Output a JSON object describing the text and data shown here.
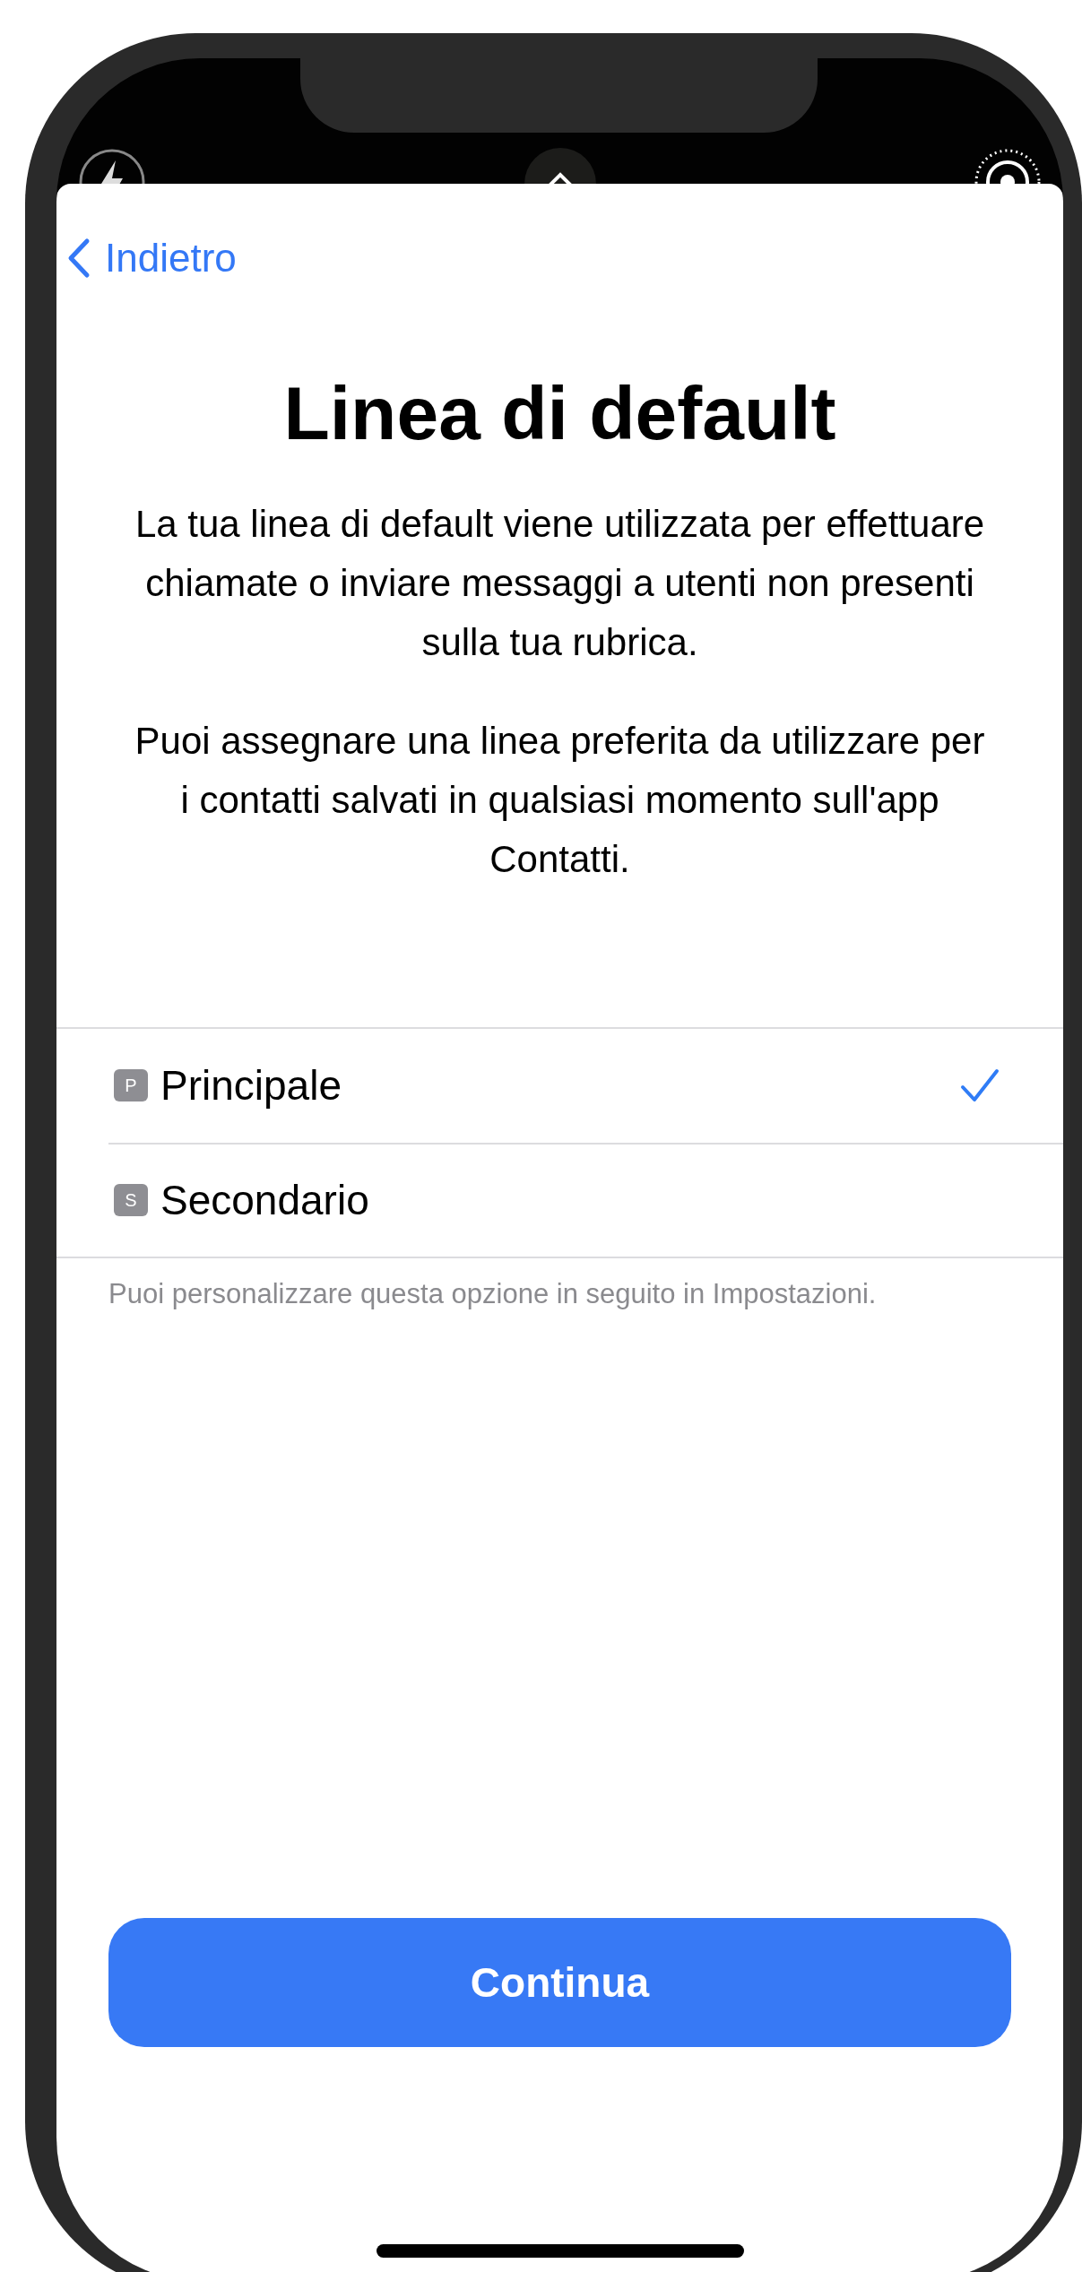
{
  "back": {
    "label": "Indietro"
  },
  "title": "Linea di default",
  "paragraphs": [
    "La tua linea di default viene utilizzata per effettuare chiamate o inviare messaggi a utenti non presenti sulla tua rubrica.",
    "Puoi assegnare una linea preferita da utilizzare per i contatti salvati in qualsiasi momento sull'app Contatti."
  ],
  "lines": [
    {
      "badge": "P",
      "label": "Principale",
      "selected": true
    },
    {
      "badge": "S",
      "label": "Secondario",
      "selected": false
    }
  ],
  "footnote": "Puoi personalizzare questa opzione in seguito in Impostazioni.",
  "button": {
    "label": "Continua"
  }
}
